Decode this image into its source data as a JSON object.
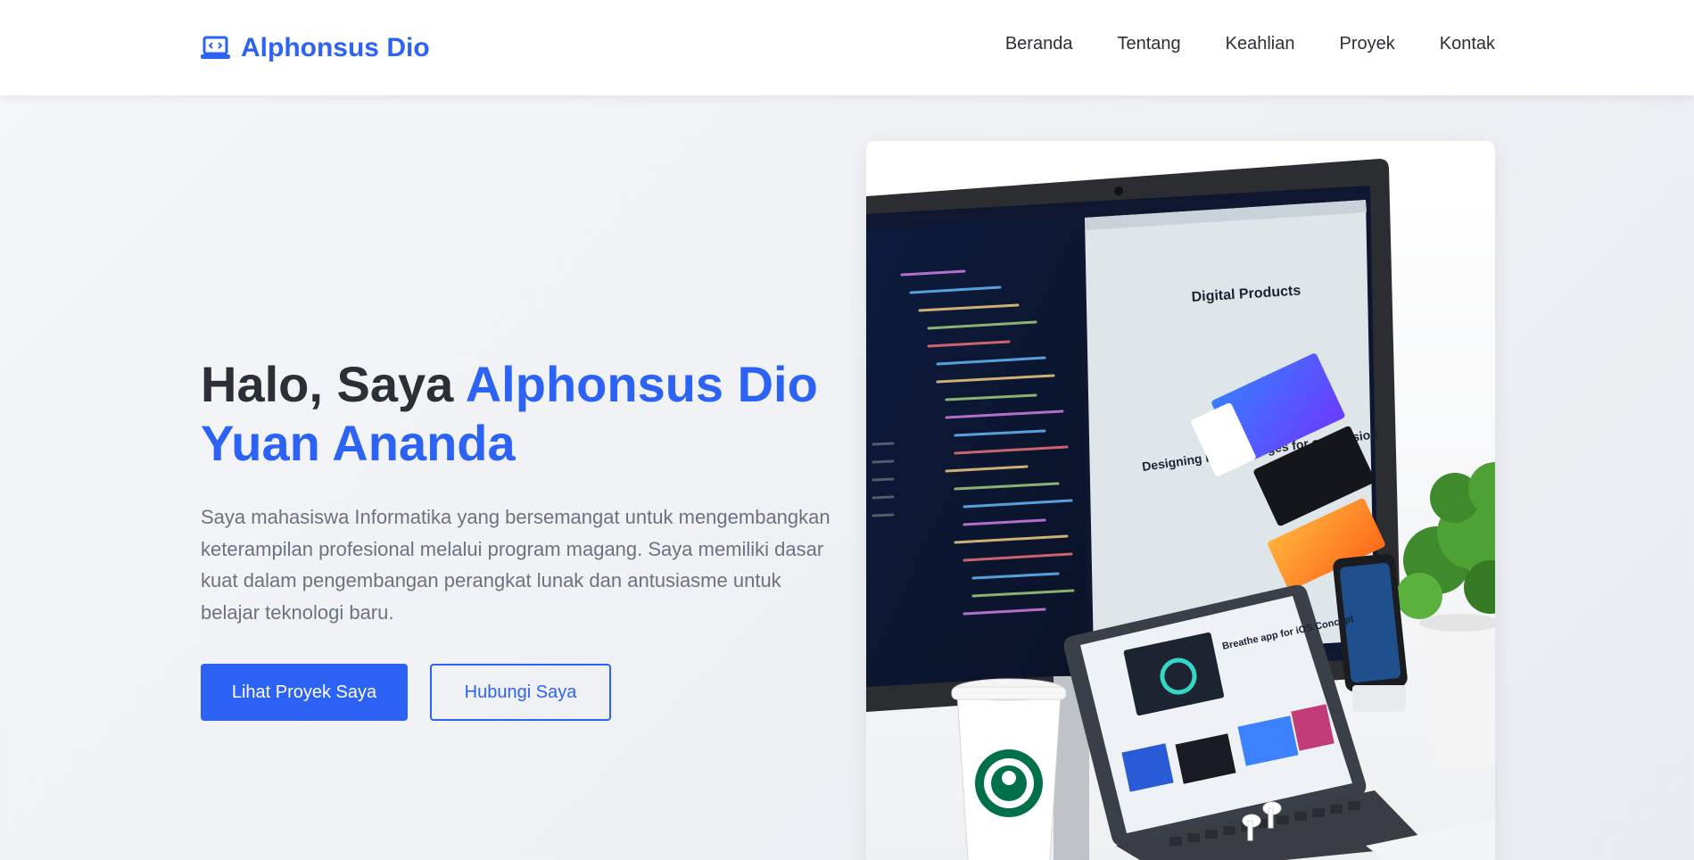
{
  "nav": {
    "brand": "Alphonsus Dio",
    "brand_icon": "laptop-code-icon",
    "links": [
      "Beranda",
      "Tentang",
      "Keahlian",
      "Proyek",
      "Kontak"
    ]
  },
  "hero": {
    "greeting": "Halo, Saya ",
    "name": "Alphonsus Dio Yuan Ananda",
    "description": "Saya mahasiswa Informatika yang bersemangat untuk mengembangkan keterampilan profesional melalui program magang. Saya memiliki dasar kuat dalam pengembangan perangkat lunak dan antusiasme untuk belajar teknologi baru.",
    "primary_button": "Lihat Proyek Saya",
    "secondary_button": "Hubungi Saya",
    "image_screen_heading": "Digital Products",
    "image_screen_subheading": "Designing landing pages for conversion",
    "image_tablet_heading": "Breathe app for iOS Concept"
  },
  "colors": {
    "accent": "#2d63f5",
    "text": "#2b2f36",
    "muted": "#6b7380",
    "background": "#eef0f3"
  }
}
